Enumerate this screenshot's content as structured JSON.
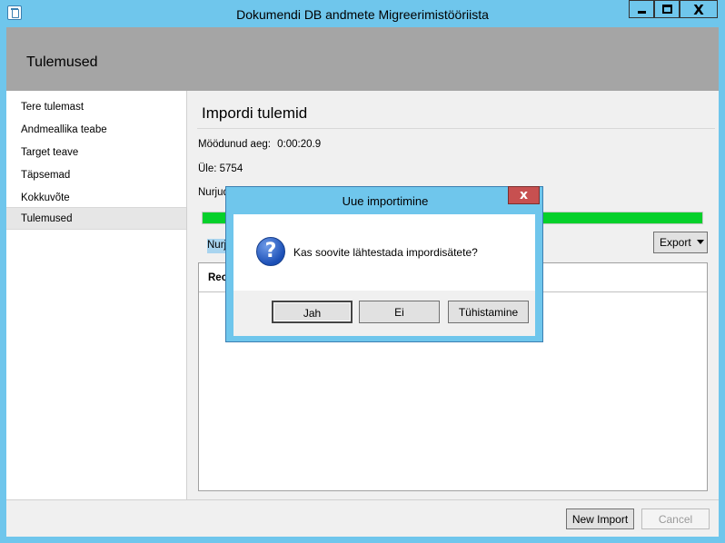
{
  "window": {
    "title": "Dokumendi DB andmete Migreerimistööriista",
    "minimize_icon": "minimize-icon",
    "maximize_icon": "maximize-icon",
    "close_glyph": "X"
  },
  "header": {
    "title": "Tulemused"
  },
  "sidebar": {
    "items": [
      {
        "label": "Tere tulemast"
      },
      {
        "label": "Andmeallika teabe"
      },
      {
        "label": "Target teave"
      },
      {
        "label": "Täpsemad"
      },
      {
        "label": "Kokkuvõte"
      },
      {
        "label": "Tulemused",
        "active": true
      }
    ]
  },
  "main": {
    "title": "Impordi tulemid",
    "elapsed_label": "Möödunud aeg:",
    "elapsed_value": "0:00:20.9",
    "transferred": "Üle: 5754",
    "failed": "Nurjuda",
    "progress": 1.0,
    "tab_label": "Nurjuda",
    "export_label": "Export",
    "grid_header": "Rec"
  },
  "footer": {
    "new_import": "New Import",
    "cancel": "Cancel"
  },
  "dialog": {
    "title": "Uue importimine",
    "close_glyph": "x",
    "icon": "question-icon",
    "icon_glyph": "?",
    "message": "Kas soovite lähtestada impordisätete?",
    "yes": "Jah",
    "no": "Ei",
    "cancel": "Tühistamine"
  },
  "colors": {
    "title_bar": "#6fc6ec",
    "progress": "#06d02b",
    "dialog_close": "#c75050"
  }
}
